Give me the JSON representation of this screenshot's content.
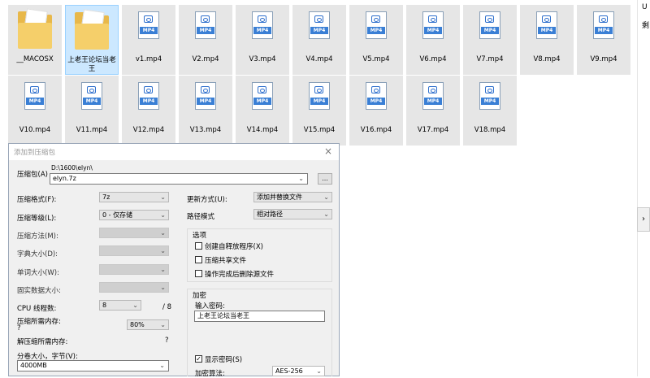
{
  "files": {
    "row1": [
      {
        "name": "__MACOSX",
        "type": "folder",
        "selected": false
      },
      {
        "name": "上老王论坛当老王",
        "type": "folder",
        "selected": true
      },
      {
        "name": "v1.mp4",
        "type": "mp4"
      },
      {
        "name": "V2.mp4",
        "type": "mp4"
      },
      {
        "name": "V3.mp4",
        "type": "mp4"
      },
      {
        "name": "V4.mp4",
        "type": "mp4"
      },
      {
        "name": "V5.mp4",
        "type": "mp4"
      },
      {
        "name": "V6.mp4",
        "type": "mp4"
      },
      {
        "name": "V7.mp4",
        "type": "mp4"
      },
      {
        "name": "V8.mp4",
        "type": "mp4"
      },
      {
        "name": "V9.mp4",
        "type": "mp4"
      }
    ],
    "row2": [
      {
        "name": "V10.mp4",
        "type": "mp4"
      },
      {
        "name": "V11.mp4",
        "type": "mp4"
      },
      {
        "name": "V12.mp4",
        "type": "mp4"
      },
      {
        "name": "V13.mp4",
        "type": "mp4"
      },
      {
        "name": "V14.mp4",
        "type": "mp4"
      },
      {
        "name": "V15.mp4",
        "type": "mp4"
      },
      {
        "name": "V16.mp4",
        "type": "mp4"
      },
      {
        "name": "V17.mp4",
        "type": "mp4"
      },
      {
        "name": "V18.mp4",
        "type": "mp4"
      }
    ],
    "mp4_tag": "MP4"
  },
  "sidebar": {
    "line1": "U",
    "line2": "剩",
    "arrow": "›"
  },
  "dialog": {
    "title": "添加到压缩包",
    "close": "×",
    "archive_label": "压缩包(A)",
    "archive_path": "D:\\1600\\elyn\\",
    "archive_name": "elyn.7z",
    "browse": "...",
    "format_label": "压缩格式(F):",
    "format_value": "7z",
    "level_label": "压缩等级(L):",
    "level_value": "0 - 仅存储",
    "method_label": "压缩方法(M):",
    "dict_label": "字典大小(D):",
    "word_label": "单词大小(W):",
    "solid_label": "固实数据大小:",
    "cpu_label": "CPU 线程数:",
    "cpu_value": "8",
    "cpu_total": "/ 8",
    "mem_label": "压缩所需内存:",
    "mem_q": "?",
    "mem_value": "80%",
    "demem_label": "解压缩所需内存:",
    "demem_q": "?",
    "volume_label": "分卷大小，字节(V):",
    "volume_value": "4000MB",
    "update_label": "更新方式(U):",
    "update_value": "添加并替换文件",
    "path_label": "路径模式",
    "path_value": "相对路径",
    "options_title": "选项",
    "opt1": "创建自释放程序(X)",
    "opt2": "压缩共享文件",
    "opt3": "操作完成后删除源文件",
    "encrypt_title": "加密",
    "pwd_label": "输入密码:",
    "pwd_value": "上老王论坛当老王",
    "show_pwd": "显示密码(S)",
    "show_pwd_check": "✓",
    "algo_label": "加密算法:",
    "algo_value": "AES-256",
    "caret": "⌄"
  }
}
